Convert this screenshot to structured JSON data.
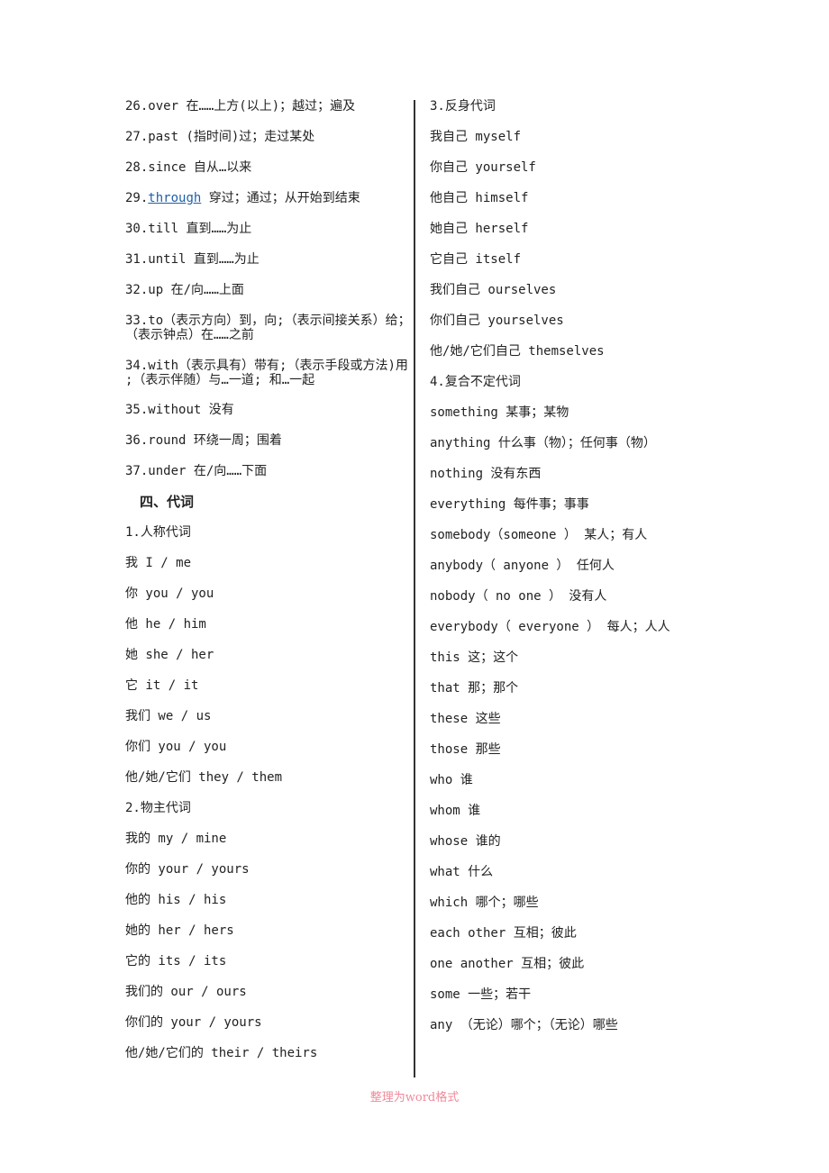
{
  "left_column": {
    "prepositions": [
      {
        "num": "26.",
        "word": "over",
        "meaning": " 在……上方(以上)；越过；遍及"
      },
      {
        "num": "27.",
        "word": "past",
        "meaning": " (指时间)过；走过某处"
      },
      {
        "num": "28.",
        "word": "since",
        "meaning": " 自从…以来"
      },
      {
        "num": "29.",
        "word": "through",
        "meaning": "  穿过；通过；从开始到结束"
      },
      {
        "num": "30.",
        "word": "till",
        "meaning": " 直到……为止"
      },
      {
        "num": "31.",
        "word": "until",
        "meaning": " 直到……为止"
      },
      {
        "num": "32.",
        "word": "up",
        "meaning": " 在/向……上面"
      },
      {
        "num": "33.",
        "word": "to",
        "meaning": "（表示方向）到，向;（表示间接关系）给；（表示钟点）在……之前"
      },
      {
        "num": "34.",
        "word": "with",
        "meaning": "（表示具有）带有;（表示手段或方法)用 ;（表示伴随）与…一道; 和…一起"
      },
      {
        "num": "35.",
        "word": "without",
        "meaning": " 没有"
      },
      {
        "num": "36.",
        "word": "round",
        "meaning": " 环绕一周；围着"
      },
      {
        "num": "37.",
        "word": "under",
        "meaning": " 在/向……下面"
      }
    ],
    "section_heading": "四、代词",
    "personal_heading": "1.人称代词",
    "personal": [
      "我 I / me",
      "你 you / you",
      "他 he / him",
      "她 she / her",
      "它 it / it",
      "我们 we / us",
      "你们 you / you",
      "他/她/它们 they / them"
    ],
    "possessive_heading": "2.物主代词",
    "possessive": [
      "我的 my / mine",
      "你的 your / yours",
      "他的 his / his",
      "她的 her / hers",
      "它的 its / its",
      "我们的 our / ours",
      "你们的 your / yours",
      "他/她/它们的 their / theirs"
    ]
  },
  "right_column": {
    "reflexive_heading": "3.反身代词",
    "reflexive": [
      "我自己 myself",
      "你自己 yourself",
      "他自己 himself",
      "她自己 herself",
      "它自己 itself",
      "我们自己 ourselves",
      "你们自己 yourselves",
      "他/她/它们自己 themselves"
    ],
    "indefinite_heading": "4.复合不定代词",
    "indefinite": [
      "something 某事；某物",
      "anything 什么事（物）；任何事（物）",
      "nothing 没有东西",
      "everything 每件事；事事",
      "somebody（someone ） 某人；有人",
      "anybody（ anyone ） 任何人",
      "nobody（ no one ） 没有人",
      "everybody（ everyone ） 每人；人人",
      "this 这；这个",
      "that 那；那个",
      "these 这些",
      "those 那些",
      "who 谁",
      "whom 谁",
      "whose 谁的",
      "what 什么",
      "which 哪个；哪些",
      "each other 互相；彼此",
      "one another 互相；彼此",
      "some 一些；若干",
      "any （无论）哪个；（无论）哪些"
    ]
  },
  "footer": "整理为word格式",
  "colors": {
    "link": "#1f5fa8",
    "footer": "#f08a9a"
  }
}
